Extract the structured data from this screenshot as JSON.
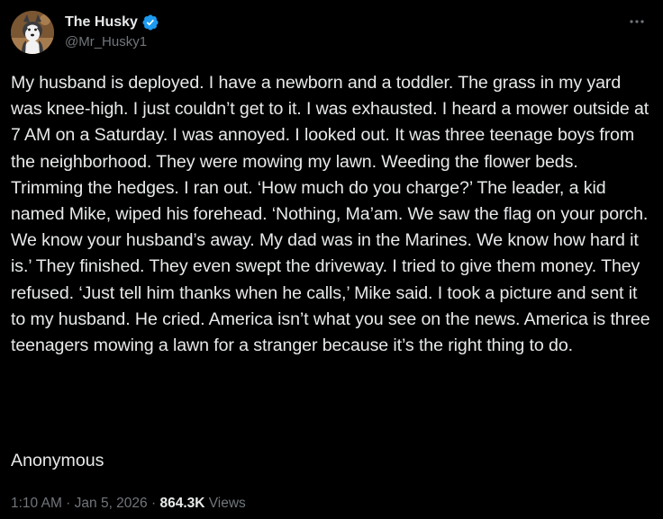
{
  "author": {
    "display_name": "The Husky",
    "handle": "@Mr_Husky1",
    "verified": true,
    "verified_color": "#1d9bf0",
    "avatar_icon": "husky-dog-avatar"
  },
  "more_menu_icon": "ellipsis-icon",
  "post": {
    "text": "My husband is deployed. I have a newborn and a toddler. The grass in my yard was knee-high. I just couldn’t get to it. I was exhausted. I heard a mower outside at 7 AM on a Saturday. I was annoyed. I looked out. It was three teenage boys from the neighborhood. They were mowing my lawn. Weeding the flower beds. Trimming the hedges. I ran out. ‘How much do you charge?’ The leader, a kid named Mike, wiped his forehead. ‘Nothing, Ma’am. We saw the flag on your porch. We know your husband’s away. My dad was in the Marines. We know how hard it is.’ They finished. They even swept the driveway. I tried to give them money. They refused. ‘Just tell him thanks when he calls,’ Mike said. I took a picture and sent it to my husband. He cried. America isn’t what you see on the news. America is three teenagers mowing a lawn for a stranger because it’s the right thing to do.",
    "signoff": "Anonymous"
  },
  "meta": {
    "time": "1:10 AM",
    "separator1": " · ",
    "date": "Jan 5, 2026",
    "separator2": " · ",
    "views_count": "864.3K",
    "views_label": " Views"
  },
  "colors": {
    "background": "#000000",
    "primary_text": "#e7e9ea",
    "secondary_text": "#71767b"
  }
}
